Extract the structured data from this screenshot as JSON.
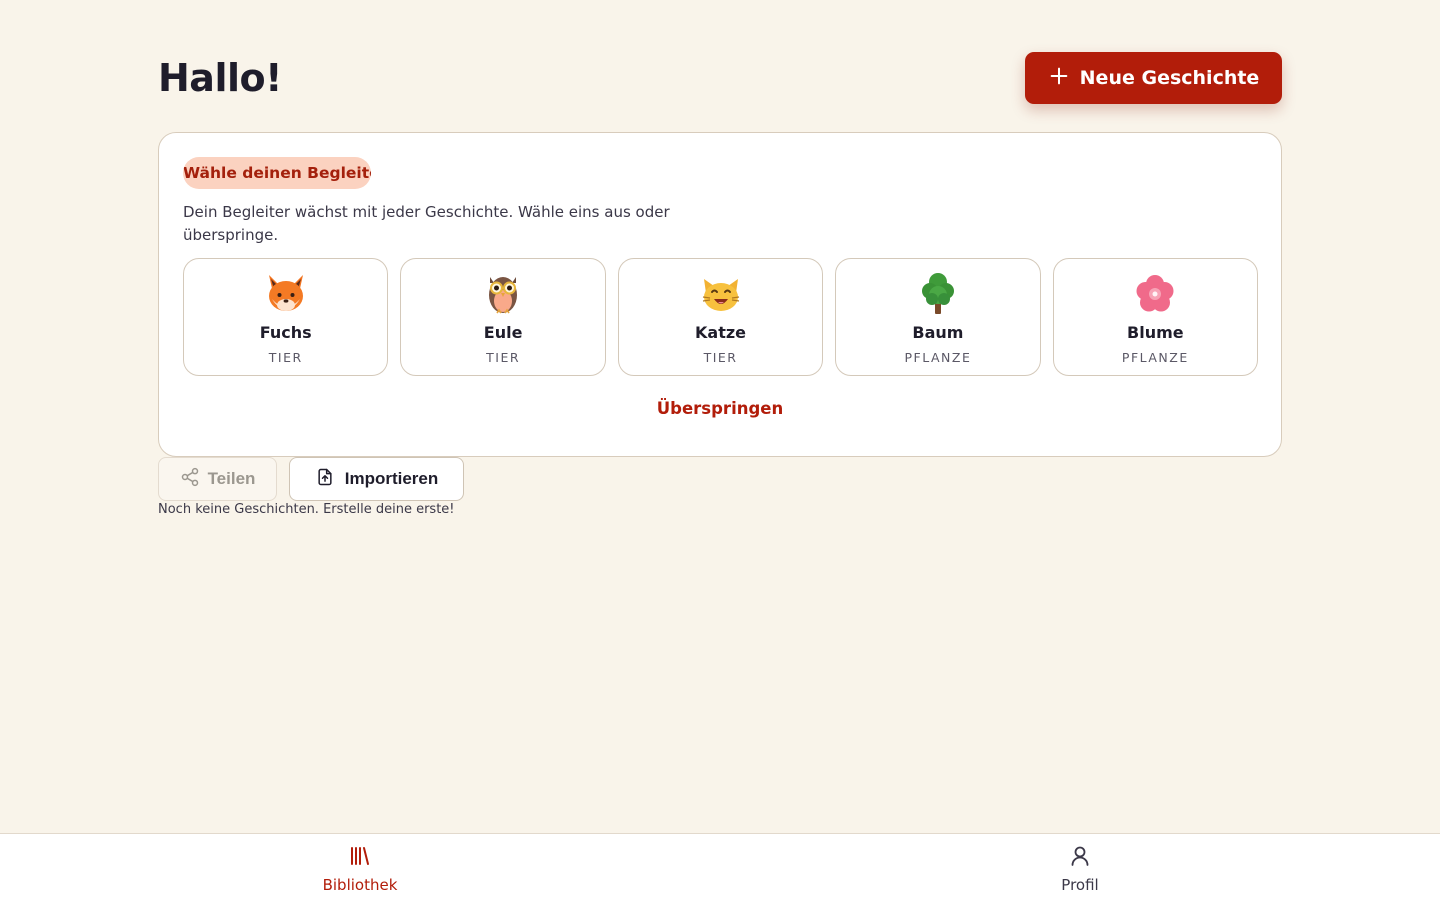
{
  "header": {
    "title": "Hallo!",
    "new_story_label": "Neue Geschichte"
  },
  "companion_picker": {
    "badge": "Wähle deinen Begleiter",
    "description": "Dein Begleiter wächst mit jeder Geschichte. Wähle eins aus oder überspringe.",
    "companions": [
      {
        "name": "Fuchs",
        "kind": "TIER",
        "icon": "fox-icon"
      },
      {
        "name": "Eule",
        "kind": "TIER",
        "icon": "owl-icon"
      },
      {
        "name": "Katze",
        "kind": "TIER",
        "icon": "cat-icon"
      },
      {
        "name": "Baum",
        "kind": "PFLANZE",
        "icon": "tree-icon"
      },
      {
        "name": "Blume",
        "kind": "PFLANZE",
        "icon": "flower-icon"
      }
    ],
    "skip_label": "Überspringen"
  },
  "actions": {
    "share_label": "Teilen",
    "import_label": "Importieren"
  },
  "empty_state": "Noch keine Geschichten. Erstelle deine erste!",
  "bottom_nav": {
    "items": [
      {
        "label": "Bibliothek",
        "icon": "library-icon",
        "active": true
      },
      {
        "label": "Profil",
        "icon": "user-icon",
        "active": false
      }
    ]
  },
  "colors": {
    "accent": "#b21d0a",
    "background": "#f9f4ea",
    "badge_bg": "#fbd2c0"
  }
}
